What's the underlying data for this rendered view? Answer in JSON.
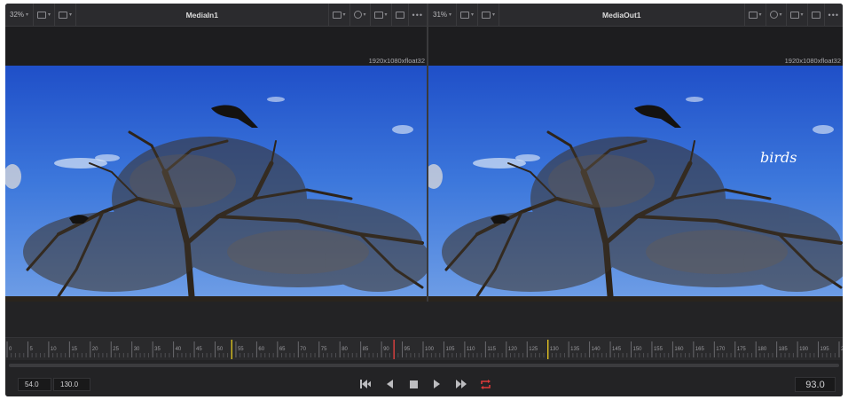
{
  "viewers": [
    {
      "zoom": "32%",
      "title": "MediaIn1",
      "resolution": "1920x1080xfloat32",
      "overlay_text": ""
    },
    {
      "zoom": "31%",
      "title": "MediaOut1",
      "resolution": "1920x1080xfloat32",
      "overlay_text": "birds"
    }
  ],
  "icons": {
    "zoom_dropdown": "chevron-down-icon",
    "view_mode": "split-view-icon",
    "channel": "rgb-channel-icon",
    "roi": "roi-icon",
    "lut": "lut-icon",
    "overlay": "overlay-icon",
    "options": "more-dots-icon"
  },
  "timeline": {
    "tick_labels": [
      "0",
      "5",
      "10",
      "15",
      "20",
      "25",
      "30",
      "35",
      "40",
      "45",
      "50",
      "55",
      "60",
      "65",
      "70",
      "75",
      "80",
      "85",
      "90",
      "95",
      "100",
      "105",
      "110",
      "115",
      "120",
      "125",
      "130",
      "135",
      "140",
      "145",
      "150",
      "155",
      "160",
      "165",
      "170",
      "175",
      "180",
      "185",
      "190",
      "195",
      "200"
    ],
    "in_marker_color": "#d8c020",
    "playhead_color": "#e0c020",
    "red_marker_color": "#e04040"
  },
  "transport": {
    "start_frame": "54.0",
    "end_frame": "130.0",
    "current_frame": "93.0",
    "buttons": [
      "go-to-start-icon",
      "play-reverse-icon",
      "stop-icon",
      "play-forward-icon",
      "go-to-end-icon",
      "loop-icon"
    ],
    "loop_active_color": "#e03a3a"
  }
}
